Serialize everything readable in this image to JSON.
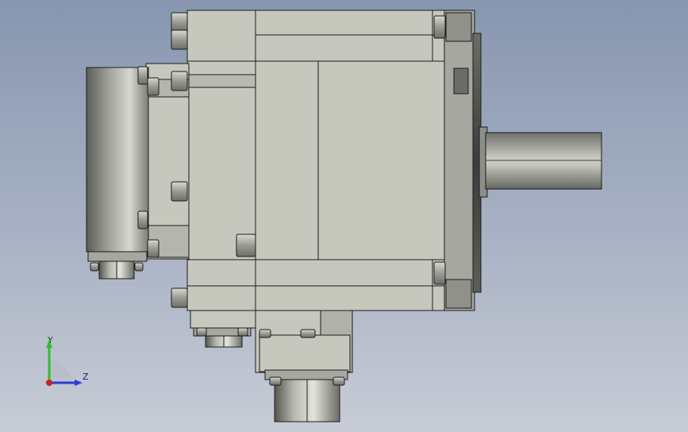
{
  "viewport": {
    "background_top": "#8796b0",
    "background_bottom": "#c7ccd6"
  },
  "model": {
    "body_color": "#c6c7bd",
    "shade_color": "#a6a89f",
    "dark_color": "#4c4e4a",
    "edge_color": "#1c1c1c"
  },
  "triad": {
    "y_label": "Y",
    "z_label": "Z",
    "y_color": "#2fbf2f",
    "z_color": "#2a3fd6",
    "x_color": "#d02020"
  }
}
